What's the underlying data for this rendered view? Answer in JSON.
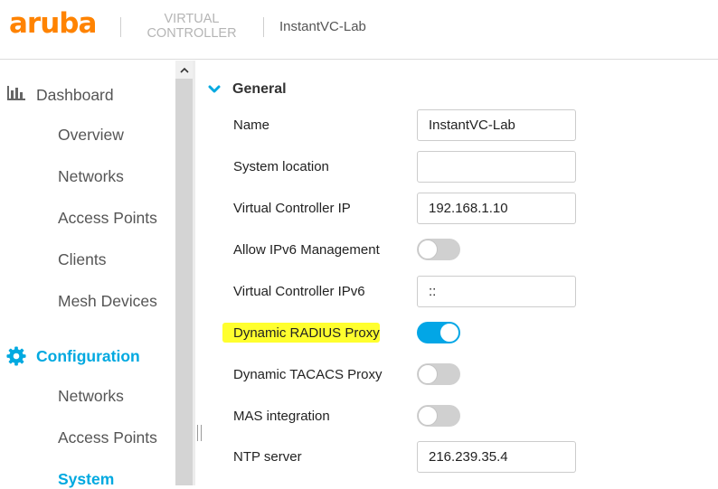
{
  "header": {
    "logo": "aruba",
    "product_line1": "VIRTUAL",
    "product_line2": "CONTROLLER",
    "instance_name": "InstantVC-Lab"
  },
  "sidebar": {
    "dashboard": {
      "label": "Dashboard",
      "icon": "bar-chart-icon",
      "items": [
        "Overview",
        "Networks",
        "Access Points",
        "Clients",
        "Mesh Devices"
      ]
    },
    "configuration": {
      "label": "Configuration",
      "icon": "gear-icon",
      "items": [
        "Networks",
        "Access Points",
        "System"
      ],
      "selected": "System"
    }
  },
  "main": {
    "section_title": "General",
    "fields": {
      "name": {
        "label": "Name",
        "value": "InstantVC-Lab"
      },
      "system_location": {
        "label": "System location",
        "value": ""
      },
      "vc_ip": {
        "label": "Virtual Controller IP",
        "value": "192.168.1.10"
      },
      "allow_ipv6": {
        "label": "Allow IPv6 Management",
        "enabled": false
      },
      "vc_ipv6": {
        "label": "Virtual Controller IPv6",
        "value": "::"
      },
      "dyn_radius": {
        "label": "Dynamic RADIUS Proxy",
        "enabled": true,
        "highlighted": true
      },
      "dyn_tacacs": {
        "label": "Dynamic TACACS Proxy",
        "enabled": false
      },
      "mas": {
        "label": "MAS integration",
        "enabled": false
      },
      "ntp": {
        "label": "NTP server",
        "value": "216.239.35.4"
      }
    }
  },
  "colors": {
    "brand": "#ff8300",
    "accent": "#01a9e0",
    "highlight": "#ffff2e",
    "toggle_off": "#d0d0d0"
  }
}
